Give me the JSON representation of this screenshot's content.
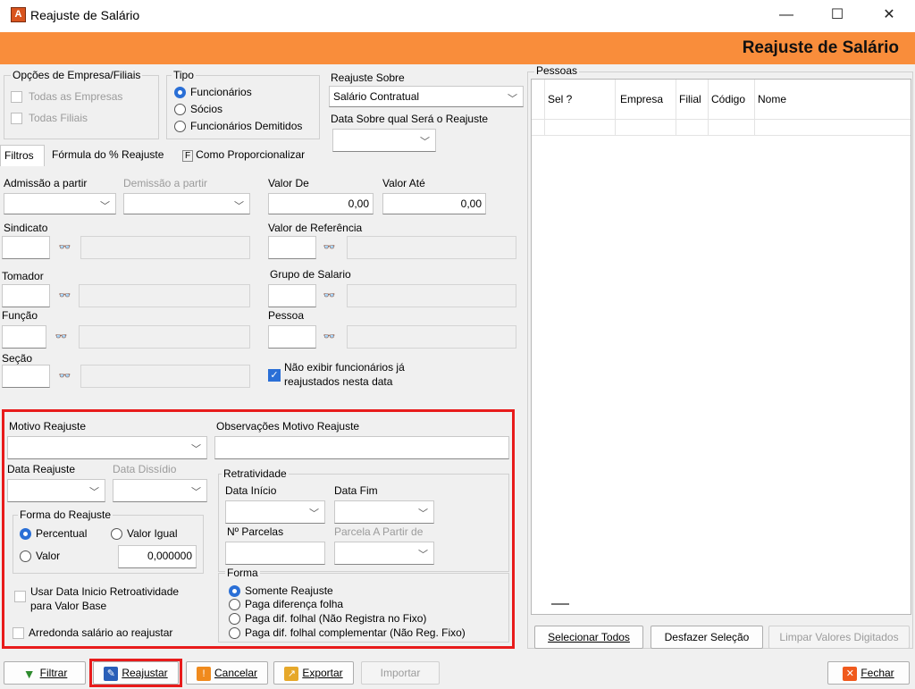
{
  "window": {
    "title": "Reajuste de Salário",
    "minimize": "—",
    "maximize": "☐",
    "close": "✕"
  },
  "banner": {
    "title": "Reajuste de Salário"
  },
  "empresa": {
    "legend": "Opções de Empresa/Filiais",
    "todas_empresas": "Todas as Empresas",
    "todas_filiais": "Todas Filiais"
  },
  "tipo": {
    "legend": "Tipo",
    "options": [
      "Funcionários",
      "Sócios",
      "Funcionários Demitidos"
    ],
    "selected": "Funcionários"
  },
  "reajuste_sobre": {
    "label": "Reajuste Sobre",
    "value": "Salário Contratual",
    "data_label": "Data Sobre qual Será o Reajuste",
    "data_value": ""
  },
  "tabs": [
    {
      "label": "Filtros",
      "active": true
    },
    {
      "label": "Fórmula do % Reajuste",
      "active": false
    },
    {
      "label": "Como Proporcionalizar",
      "key": "F",
      "active": false
    }
  ],
  "filtros": {
    "admissao_label": "Admissão a partir",
    "demissao_label": "Demissão a partir",
    "valor_de_label": "Valor  De",
    "valor_de": "0,00",
    "valor_ate_label": "Valor Até",
    "valor_ate": "0,00",
    "sindicato_label": "Sindicato",
    "valor_ref_label": "Valor de Referência",
    "tomador_label": "Tomador",
    "grupo_salario_label": "Grupo de Salario",
    "funcao_label": "Função",
    "pessoa_label": "Pessoa",
    "secao_label": "Seção",
    "nao_exibir_label": "Não exibir funcionários já reajustados nesta data",
    "nao_exibir_line1": "Não exibir funcionários já",
    "nao_exibir_line2": "reajustados nesta data"
  },
  "motivo": {
    "motivo_label": "Motivo Reajuste",
    "obs_label": "Observações Motivo Reajuste",
    "data_reajuste_label": "Data Reajuste",
    "data_dissidio_label": "Data Dissídio"
  },
  "forma_reajuste": {
    "legend": "Forma do Reajuste",
    "options": [
      "Percentual",
      "Valor Igual",
      "Valor"
    ],
    "selected": "Percentual",
    "value": "0,000000"
  },
  "usar_data": {
    "line1": "Usar Data Inicio Retroatividade",
    "line2": "para Valor Base"
  },
  "arredonda": "Arredonda salário ao reajustar",
  "retratividade": {
    "legend": "Retratividade",
    "data_inicio_label": "Data Início",
    "data_fim_label": "Data Fim",
    "parcelas_label": "Nº Parcelas",
    "parcela_partir_label": "Parcela A Partir de"
  },
  "forma": {
    "legend": "Forma",
    "options": [
      "Somente Reajuste",
      "Paga diferença folha",
      "Paga dif. folhal (Não Registra no Fixo)",
      "Paga dif. folhal complementar (Não Reg. Fixo)"
    ],
    "selected": "Somente Reajuste"
  },
  "pessoas": {
    "legend": "Pessoas",
    "columns": [
      "Sel ?",
      "Empresa",
      "Filial",
      "Código",
      "Nome"
    ]
  },
  "grid_buttons": {
    "selecionar": "Selecionar Todos",
    "desfazer": "Desfazer Seleção",
    "limpar": "Limpar Valores Digitados"
  },
  "toolbar": {
    "filtrar": "Filtrar",
    "reajustar": "Reajustar",
    "cancelar": "Cancelar",
    "exportar": "Exportar",
    "importar": "Importar",
    "fechar": "Fechar"
  },
  "colors": {
    "banner": "#f98d3b",
    "highlight": "#e81b1b",
    "accent": "#2a6fd6"
  }
}
